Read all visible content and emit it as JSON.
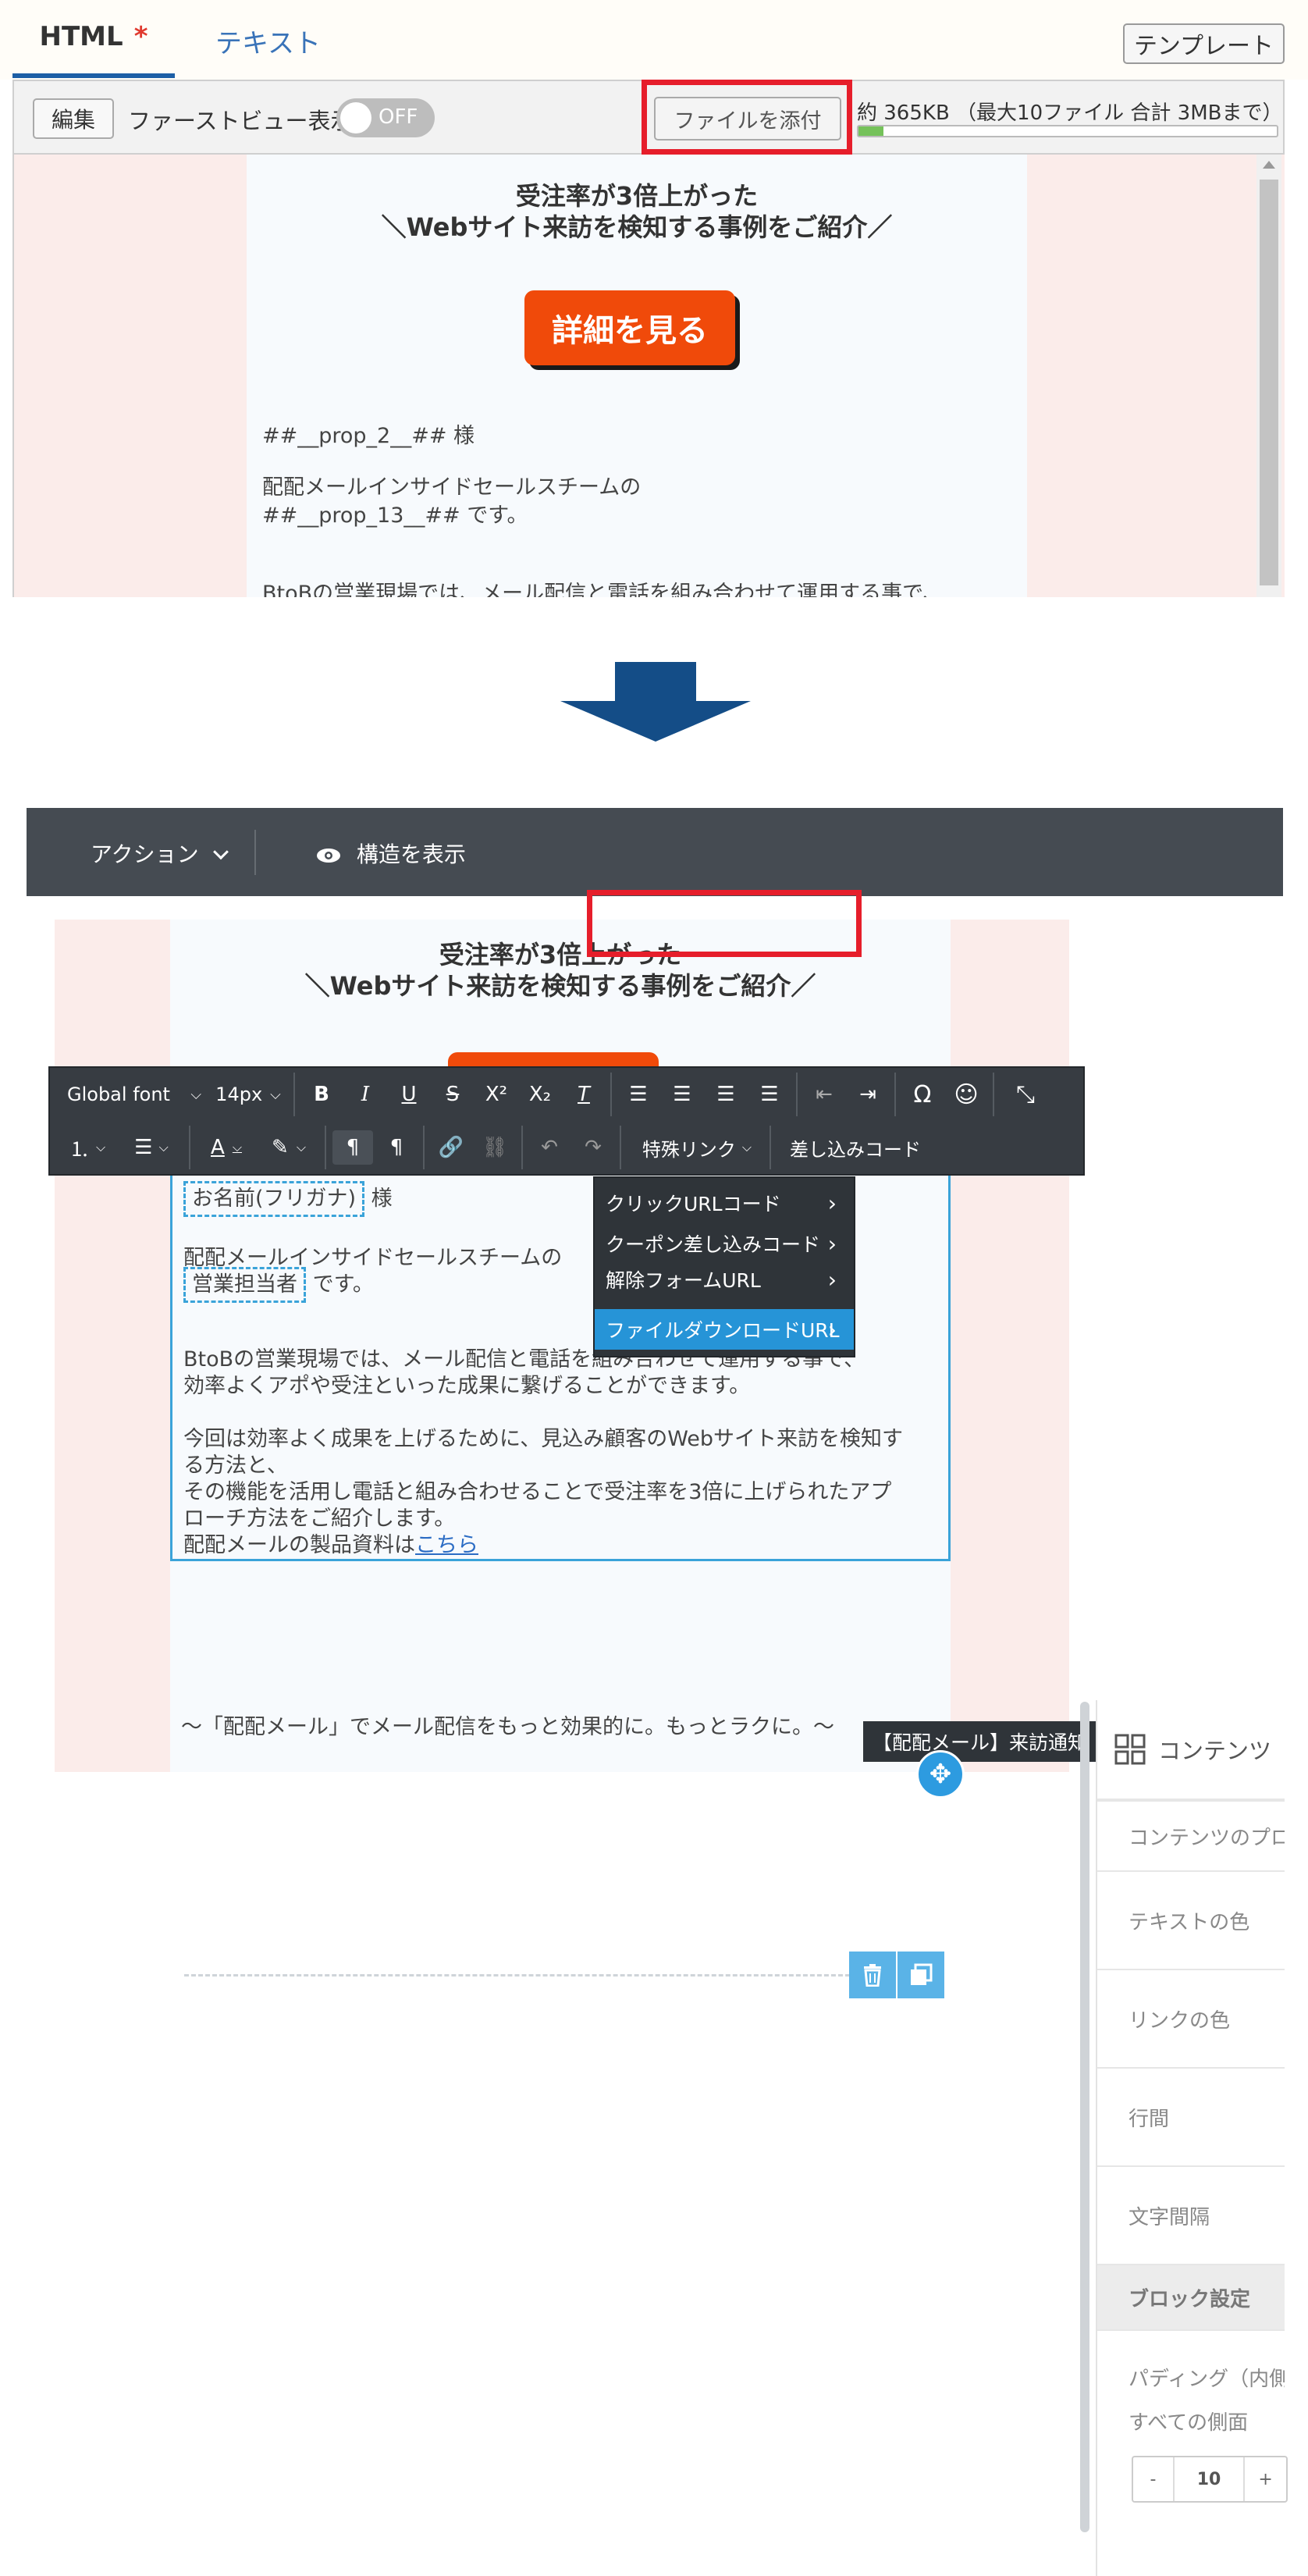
{
  "top_panel": {
    "tabs": {
      "html": "HTML",
      "html_required_mark": "*",
      "text": "テキスト"
    },
    "template_button": "テンプレート",
    "toolbar": {
      "edit_button": "編集",
      "first_view_label": "ファーストビュー表示",
      "toggle_state": "OFF",
      "attach_button": "ファイルを添付",
      "size_text": "約 365KB （最大10ファイル 合計 3MBまで）",
      "size_fraction": 0.06
    },
    "preview": {
      "title_line1": "受注率が3倍上がった",
      "title_line2": "＼Webサイト来訪を検知する事例をご紹介／",
      "cta_label": "詳細を見る",
      "greeting": "##__prop_2__## 様",
      "intro_line1": "配配メールインサイドセールスチームの",
      "intro_line2": "##__prop_13__## です。",
      "body_line1": "BtoBの営業現場では、メール配信と電話を組み合わせて運用する事で、"
    }
  },
  "bottom_panel": {
    "topbar": {
      "actions": "アクション",
      "show_structure": "構造を表示"
    },
    "format_toolbar": {
      "font": "Global font",
      "size": "14px",
      "special_link": "特殊リンク",
      "insert_code": "差し込みコード"
    },
    "mail": {
      "title_line1": "受注率が3倍上がった",
      "title_line2": "＼Webサイト来訪を検知する事例をご紹介／",
      "name_tag": "お名前(フリガナ)",
      "name_suffix": "様",
      "intro_line1": "配配メールインサイドセールスチームの",
      "staff_tag": "営業担当者",
      "staff_suffix": "です。",
      "para1_line1": "BtoBの営業現場では、メール配信と電話を組み合わせて運用する事で、",
      "para1_line2": "効率よくアポや受注といった成果に繋げることができます。",
      "para2_line1": "今回は効率よく成果を上げるために、見込み顧客のWebサイト来訪を検知す",
      "para2_line2": "る方法と、",
      "para2_line3": "その機能を活用し電話と組み合わせることで受注率を3倍に上げられたアプ",
      "para2_line4": "ローチ方法をご紹介します。",
      "doc_prefix": "配配メールの製品資料は",
      "doc_link": "こちら",
      "footer_line": "～「配配メール」でメール配信をもっと効果的に。もっとラクに。～"
    },
    "special_link_menu": [
      {
        "label": "クリックURLコード"
      },
      {
        "label": "クーポン差し込みコード"
      },
      {
        "label": "解除フォームURL"
      },
      {
        "label": "ファイルダウンロードURL"
      }
    ],
    "submenu_item": "【配配メール】来訪通知",
    "side_panel": {
      "header": "コンテンツ",
      "items": [
        "コンテンツのプロパティ",
        "テキストの色",
        "リンクの色",
        "行間",
        "文字間隔",
        "ブロック設定",
        "パディング（内側）",
        "すべての側面"
      ],
      "padding_value": "10",
      "minus": "-",
      "plus": "+"
    }
  },
  "colors": {
    "accent_red": "#e61e2b",
    "cta_orange": "#f04a0a",
    "selection_blue": "#3aa3d9",
    "menu_active": "#2694d7",
    "arrow_blue": "#144d87"
  }
}
